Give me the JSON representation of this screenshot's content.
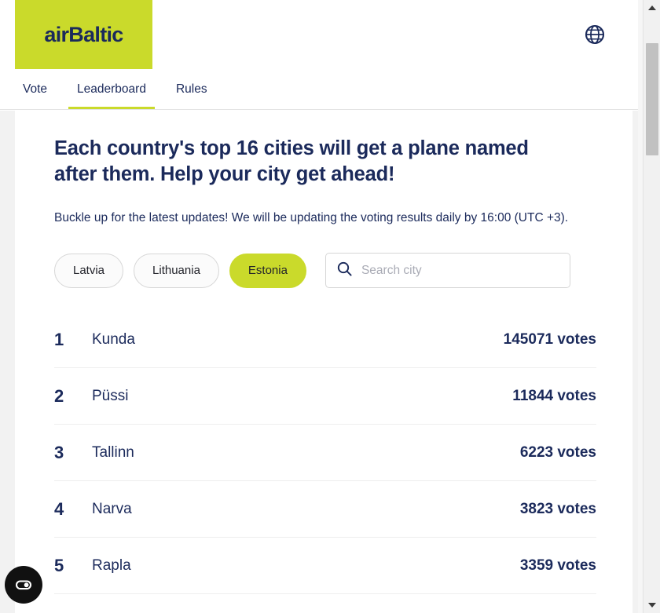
{
  "brand": {
    "logo_text": "airBaltic",
    "logo_bg": "#cada2b",
    "navy": "#1b2a5b",
    "lime": "#cada2b"
  },
  "header": {
    "language_icon": "globe-icon"
  },
  "tabs": [
    {
      "label": "Vote",
      "active": false
    },
    {
      "label": "Leaderboard",
      "active": true
    },
    {
      "label": "Rules",
      "active": false
    }
  ],
  "main": {
    "headline": "Each country's top 16 cities will get a plane named after them. Help your city get ahead!",
    "subtext": "Buckle up for the latest updates! We will be updating the voting results daily by 16:00 (UTC +3)."
  },
  "filters": {
    "chips": [
      {
        "label": "Latvia",
        "selected": false
      },
      {
        "label": "Lithuania",
        "selected": false
      },
      {
        "label": "Estonia",
        "selected": true
      }
    ]
  },
  "search": {
    "icon": "search-icon",
    "placeholder": "Search city",
    "value": ""
  },
  "leaderboard": {
    "votes_suffix": "votes",
    "rows": [
      {
        "rank": "1",
        "city": "Kunda",
        "votes": "145071 votes"
      },
      {
        "rank": "2",
        "city": "Püssi",
        "votes": "11844 votes"
      },
      {
        "rank": "3",
        "city": "Tallinn",
        "votes": "6223 votes"
      },
      {
        "rank": "4",
        "city": "Narva",
        "votes": "3823 votes"
      },
      {
        "rank": "5",
        "city": "Rapla",
        "votes": "3359 votes"
      }
    ]
  },
  "consent": {
    "icon": "cookie-consent-icon"
  },
  "scrollbar": {
    "up_icon": "scroll-up-arrow-icon",
    "down_icon": "scroll-down-arrow-icon",
    "thumb": "scrollbar-thumb"
  }
}
